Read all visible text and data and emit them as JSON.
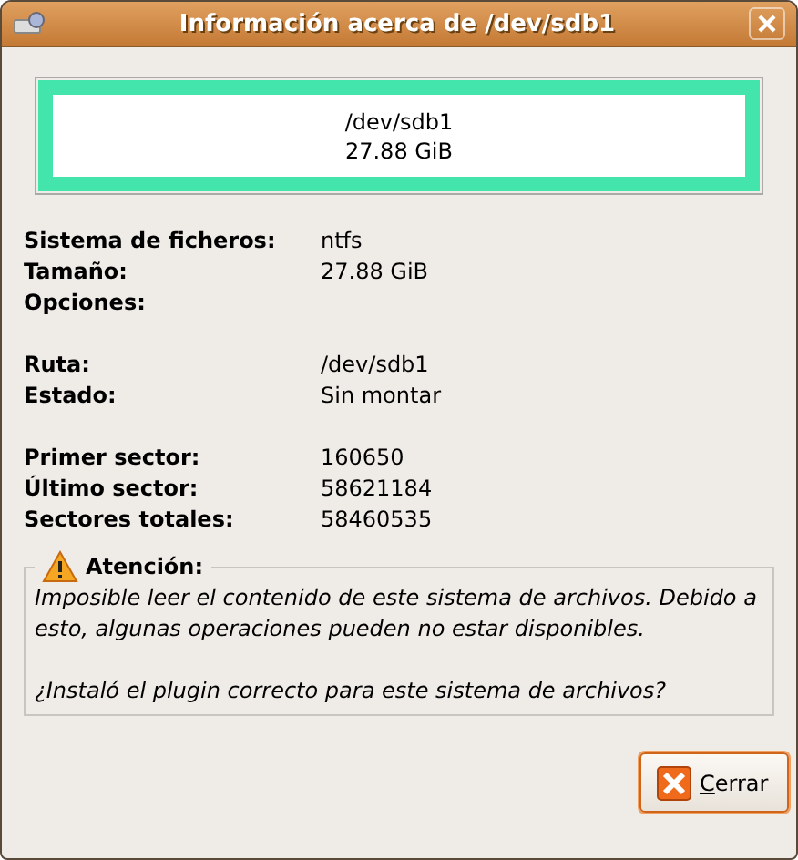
{
  "window": {
    "title": "Información acerca de /dev/sdb1"
  },
  "partition": {
    "name": "/dev/sdb1",
    "size": "27.88 GiB",
    "color": "#44e4ad"
  },
  "info_groups": [
    [
      {
        "label": "Sistema de ficheros:",
        "value": "ntfs"
      },
      {
        "label": "Tamaño:",
        "value": "27.88 GiB"
      },
      {
        "label": "Opciones:"
      }
    ],
    [
      {
        "label": "Ruta:",
        "value": "/dev/sdb1"
      },
      {
        "label": "Estado:",
        "value": "Sin montar"
      }
    ],
    [
      {
        "label": "Primer sector:",
        "value": "160650"
      },
      {
        "label": "Último sector:",
        "value": "58621184"
      },
      {
        "label": "Sectores totales:",
        "value": "58460535"
      }
    ]
  ],
  "warning": {
    "title": "Atención:",
    "paragraphs": [
      "Imposible leer el contenido de este sistema de archivos. Debido a esto, algunas operaciones pueden no estar disponibles.",
      "¿Instaló el plugin correcto para este sistema de archivos?"
    ]
  },
  "buttons": [
    {
      "label": "Cerrar"
    }
  ]
}
